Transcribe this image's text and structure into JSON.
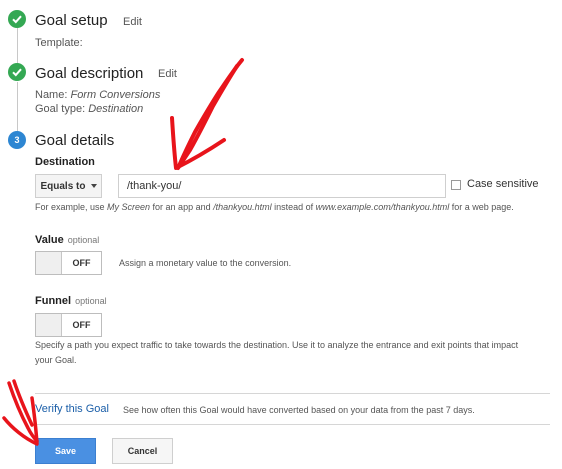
{
  "steps": {
    "setup": {
      "title": "Goal setup",
      "edit": "Edit",
      "template_label": "Template:"
    },
    "description": {
      "title": "Goal description",
      "edit": "Edit",
      "name_label": "Name:",
      "name_value": "Form Conversions",
      "type_label": "Goal type:",
      "type_value": "Destination"
    },
    "details": {
      "number": "3",
      "title": "Goal details"
    }
  },
  "destination": {
    "label": "Destination",
    "match_type": "Equals to",
    "value": "/thank-you/",
    "case_sensitive_label": "Case sensitive",
    "case_sensitive_checked": false,
    "hint": {
      "p1": "For example, use ",
      "e1": "My Screen",
      "p2": " for an app and ",
      "e2": "/thankyou.html",
      "p3": " instead of ",
      "e3": "www.example.com/thankyou.html",
      "p4": " for a web page."
    }
  },
  "value_section": {
    "label": "Value",
    "optional": "optional",
    "toggle_state": "OFF",
    "description": "Assign a monetary value to the conversion."
  },
  "funnel_section": {
    "label": "Funnel",
    "optional": "optional",
    "toggle_state": "OFF",
    "description_line1": "Specify a path you expect traffic to take towards the destination. Use it to analyze the entrance and exit points that impact",
    "description_line2": "your Goal."
  },
  "verify": {
    "link": "Verify this Goal",
    "description": "See how often this Goal would have converted based on your data from the past 7 days."
  },
  "buttons": {
    "save": "Save",
    "cancel": "Cancel"
  },
  "colors": {
    "check_green": "#34a853",
    "step_blue": "#2d86d2",
    "save_blue": "#4a90e2",
    "link_blue": "#1a5ea8",
    "annotation_red": "#e8141b"
  }
}
